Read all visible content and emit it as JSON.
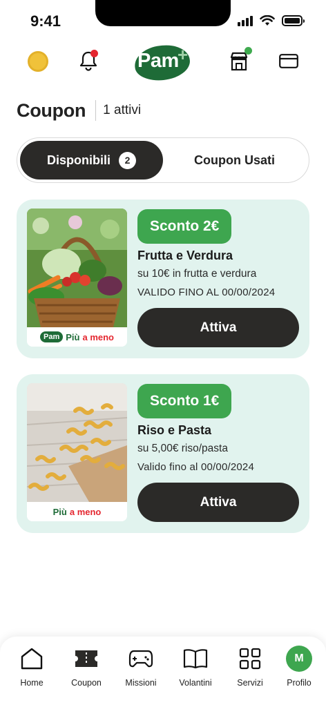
{
  "status_bar": {
    "time": "9:41"
  },
  "header": {
    "logo_text": "Pam",
    "logo_plus": "+",
    "colors": {
      "brand_green": "#1e6b37",
      "accent_green": "#3ea64f",
      "alert_red": "#e4262f",
      "coin_yellow": "#f0c23a"
    },
    "icons": [
      "coin-icon",
      "bell-icon",
      "pam-logo",
      "store-icon",
      "card-icon"
    ]
  },
  "page": {
    "title": "Coupon",
    "active_count": "1 attivi"
  },
  "tabs": {
    "available_label": "Disponibili",
    "available_count": "2",
    "used_label": "Coupon Usati"
  },
  "coupons": [
    {
      "discount": "Sconto 2€",
      "title": "Frutta e Verdura",
      "description": "su 10€ in frutta e verdura",
      "validity": "VALIDO FINO AL 00/00/2024",
      "button": "Attiva",
      "image_footer": {
        "logo": "Pam",
        "piu": "Più",
        "meno": "a meno"
      }
    },
    {
      "discount": "Sconto 1€",
      "title": "Riso e Pasta",
      "description": "su 5,00€ riso/pasta",
      "validity": "Valido fino al 00/00/2024",
      "button": "Attiva",
      "image_footer": {
        "piu": "Più",
        "meno": "a meno"
      }
    }
  ],
  "bottom_nav": [
    {
      "label": "Home",
      "icon": "home-icon"
    },
    {
      "label": "Coupon",
      "icon": "ticket-icon"
    },
    {
      "label": "Missioni",
      "icon": "gamepad-icon"
    },
    {
      "label": "Volantini",
      "icon": "book-icon"
    },
    {
      "label": "Servizi",
      "icon": "grid-icon"
    },
    {
      "label": "Profilo",
      "icon": "avatar",
      "avatar_initial": "M"
    }
  ]
}
